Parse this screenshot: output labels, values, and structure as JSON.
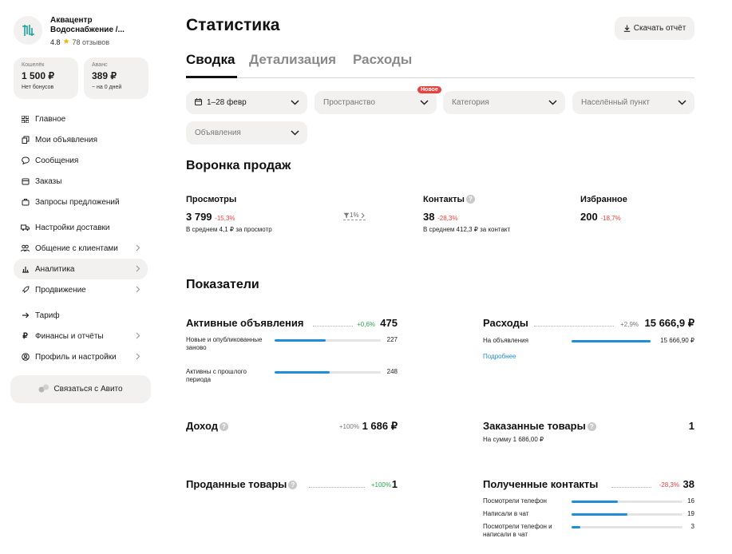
{
  "company": {
    "name": "Аквацентр Водоснабжение /...",
    "rating": "4.8",
    "reviews": "78 отзывов"
  },
  "wallets": [
    {
      "label": "Кошелёк",
      "amount": "1 500 ₽",
      "note": "Нет бонусов"
    },
    {
      "label": "Аванс",
      "amount": "389 ₽",
      "note": "~ на 0 дней"
    }
  ],
  "nav": [
    {
      "label": "Главное",
      "icon": "grid-icon"
    },
    {
      "label": "Мои объявления",
      "icon": "copy-icon"
    },
    {
      "label": "Сообщения",
      "icon": "chat-icon"
    },
    {
      "label": "Заказы",
      "icon": "box-icon"
    },
    {
      "label": "Запросы предложений",
      "icon": "briefcase-icon"
    },
    {
      "label": "Настройки доставки",
      "icon": "truck-icon"
    },
    {
      "label": "Общение с клиентами",
      "icon": "people-icon"
    },
    {
      "label": "Аналитика",
      "icon": "chart-icon"
    },
    {
      "label": "Продвижение",
      "icon": "rocket-icon"
    },
    {
      "label": "Тариф",
      "icon": "arrow-icon"
    },
    {
      "label": "Финансы и отчёты",
      "icon": "ruble-icon"
    },
    {
      "label": "Профиль и настройки",
      "icon": "user-icon"
    }
  ],
  "contact_button": "Связаться с Авито",
  "page": {
    "title": "Статистика",
    "download": "Скачать отчёт"
  },
  "tabs": [
    "Сводка",
    "Детализация",
    "Расходы"
  ],
  "filters": {
    "date": "1–28 февр",
    "space": "Пространство",
    "new_badge": "Новое",
    "category": "Категория",
    "locality": "Населённый пункт",
    "ads": "Объявления"
  },
  "funnel": {
    "title": "Воронка продаж",
    "views": {
      "label": "Просмотры",
      "value": "3 799",
      "change": "-15,3%",
      "sub": "В среднем 4,1 ₽ за просмотр"
    },
    "conversion": "1%",
    "contacts": {
      "label": "Контакты",
      "value": "38",
      "change": "-28,3%",
      "sub": "В среднем 412,3 ₽ за контакт"
    },
    "favorites": {
      "label": "Избранное",
      "value": "200",
      "change": "-18,7%"
    }
  },
  "indicators": {
    "title": "Показатели",
    "active_ads": {
      "title": "Активные объявления",
      "change": "+0,6%",
      "value": "475",
      "rows": [
        {
          "label": "Новые и опубликованные заново",
          "value": "227",
          "fraction": 0.478
        },
        {
          "label": "Активны с прошлого периода",
          "value": "248",
          "fraction": 0.522
        }
      ]
    },
    "expenses": {
      "title": "Расходы",
      "change": "+2,9%",
      "value": "15 666,9 ₽",
      "rows": [
        {
          "label": "На объявления",
          "value": "15 666,90 ₽",
          "fraction": 1.0
        }
      ],
      "link": "Подробнее"
    },
    "income": {
      "title": "Доход",
      "change": "+100%",
      "value": "1 686 ₽"
    },
    "ordered": {
      "title": "Заказанные товары",
      "value": "1",
      "sub": "На сумму 1 686,00 ₽"
    },
    "sold": {
      "title": "Проданные товары",
      "change": "+100%",
      "value": "1"
    },
    "received_contacts": {
      "title": "Полученные контакты",
      "change": "-28,3%",
      "value": "38",
      "rows": [
        {
          "label": "Посмотрели телефон",
          "value": "16",
          "fraction": 0.42
        },
        {
          "label": "Написали в чат",
          "value": "19",
          "fraction": 0.5
        },
        {
          "label": "Посмотрели телефон и написали в чат",
          "value": "3",
          "fraction": 0.08
        }
      ]
    }
  },
  "colors": {
    "accent": "#1e8ed6",
    "negative": "#e8413e",
    "positive": "#2aa84a",
    "surface": "#f2f1ef"
  }
}
